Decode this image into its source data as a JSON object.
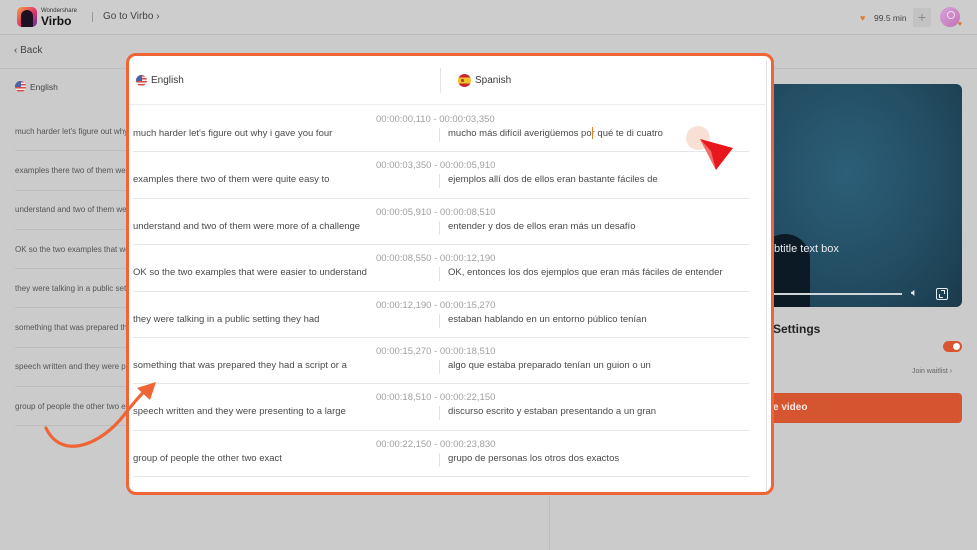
{
  "topbar": {
    "brand_small": "Wondershare",
    "brand_big": "Virbo",
    "goto_label": "Go to Virbo",
    "goto_chevron": "›",
    "credits": "99.5 min",
    "plus_label": "+"
  },
  "nav": {
    "back_label": "Back",
    "back_chevron": "‹"
  },
  "left_panel": {
    "language": "English",
    "items": [
      "much harder let's figure out why i gave you four",
      "examples there two of them were quite easy to",
      "understand and two of them were more of a challenge",
      "OK so the two examples that were easier to understand",
      "they were talking in a public setting they had",
      "something that was prepared they had a script or a",
      "speech written and they were presenting to a large",
      "group of people the other two exact"
    ]
  },
  "right_panel": {
    "subtitle_preview": "btitle text box",
    "settings_title": "Settings",
    "toggle_on": true,
    "join_waitlist": "Join waitlist",
    "join_chevron": "›",
    "create_label": "e video"
  },
  "modal": {
    "source_language": "English",
    "target_language": "Spanish",
    "rows": [
      {
        "time": "00:00:00,110 - 00:00:03,350",
        "en": "much harder let's figure out why i gave you four",
        "es": "mucho más difícil averigüemos por qué te di cuatro"
      },
      {
        "time": "00:00:03,350 - 00:00:05,910",
        "en": "examples there two of them were quite easy to",
        "es": "ejemplos allí dos de ellos eran bastante fáciles de"
      },
      {
        "time": "00:00:05,910 - 00:00:08,510",
        "en": "understand and two of them were more of a challenge",
        "es": "entender y dos de ellos eran más un desafío"
      },
      {
        "time": "00:00:08,550 - 00:00:12,190",
        "en": "OK so the two examples that were easier to understand",
        "es": "OK, entonces los dos ejemplos que eran más fáciles de entender"
      },
      {
        "time": "00:00:12,190 - 00:00:15,270",
        "en": "they were talking in a public setting they had",
        "es": "estaban hablando en un entorno público tenían"
      },
      {
        "time": "00:00:15,270 - 00:00:18,510",
        "en": "something that was prepared they had a script or a",
        "es": "algo que estaba preparado tenían un guion o un"
      },
      {
        "time": "00:00:18,510 - 00:00:22,150",
        "en": "speech written and they were presenting to a large",
        "es": "discurso escrito y estaban presentando a un gran"
      },
      {
        "time": "00:00:22,150 - 00:00:23,830",
        "en": "group of people the other two exact",
        "es": "grupo de personas los otros dos exactos"
      }
    ]
  },
  "colors": {
    "accent": "#ef6536",
    "button": "#d4552f",
    "cursor_red": "#e8171c"
  }
}
